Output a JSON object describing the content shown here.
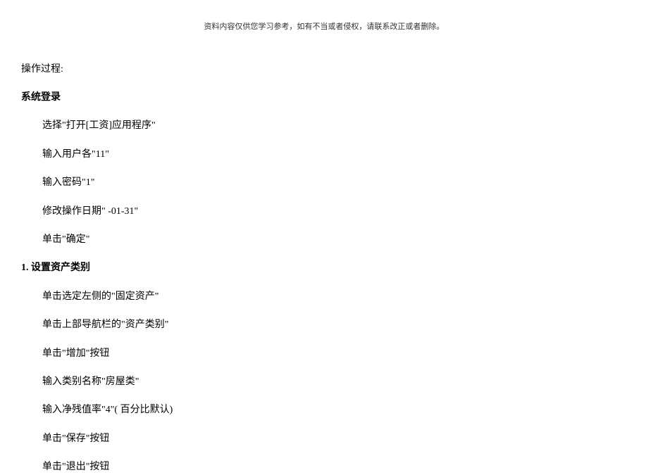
{
  "header": {
    "note": "资料内容仅供您学习参考，如有不当或者侵权，请联系改正或者删除。"
  },
  "content": {
    "processTitle": "操作过程:",
    "section1": {
      "title": "系统登录",
      "steps": [
        "选择\"打开[工资]应用程序\"",
        "输入用户各\"11\"",
        "输入密码\"1\"",
        "修改操作日期\" -01-31\"",
        "单击\"确定\""
      ]
    },
    "section2": {
      "title": "1. 设置资产类别",
      "steps": [
        "单击选定左侧的\"固定资产\"",
        "单击上部导航栏的\"资产类别\"",
        "单击\"增加\"按钮",
        "输入类别名称\"房屋类\"",
        "输入净残值率\"4\"( 百分比默认)",
        "单击\"保存\"按钮",
        "单击\"退出\"按钮"
      ]
    }
  }
}
